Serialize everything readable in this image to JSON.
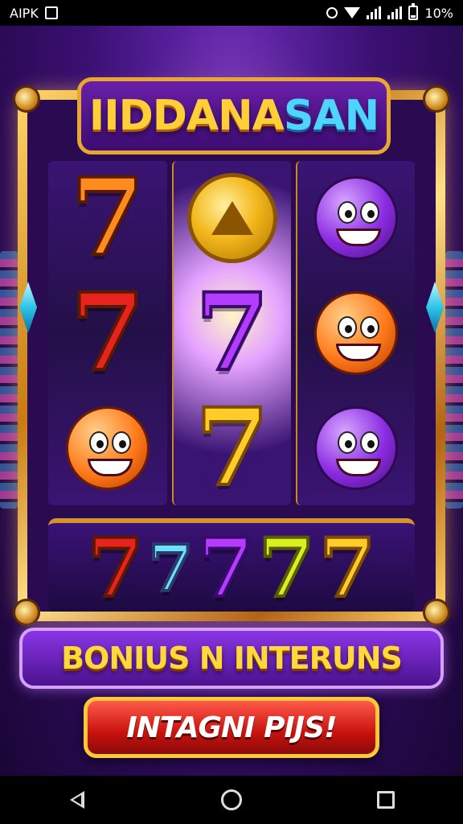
{
  "status_bar": {
    "left_label": "AIPK",
    "battery": "10%"
  },
  "game": {
    "title_main": "IIDDANA",
    "title_accent": "SAN",
    "reels": [
      [
        "seven-orange",
        "seven-red",
        "orange-character"
      ],
      [
        "gold-coin",
        "seven-purple",
        "seven-gold"
      ],
      [
        "purple-blob-character",
        "orange-duck-character",
        "purple-blob-character"
      ]
    ],
    "bottom_row": [
      "7",
      "7",
      "7",
      "7",
      "7"
    ],
    "seven_glyph": "7",
    "bonus_banner": "BONIUS N INTERUNS",
    "play_button": "INTAGNI PIJS!"
  },
  "colors": {
    "title": "#ffcf3a",
    "title_accent": "#4fd3ff",
    "bonus_text": "#ffd93a",
    "play_button": "#c8120e",
    "frame_gold": "#e8a632"
  },
  "nav_bar": {
    "back_icon": "back-triangle-icon",
    "home_icon": "home-circle-icon",
    "recents_icon": "recents-square-icon"
  }
}
